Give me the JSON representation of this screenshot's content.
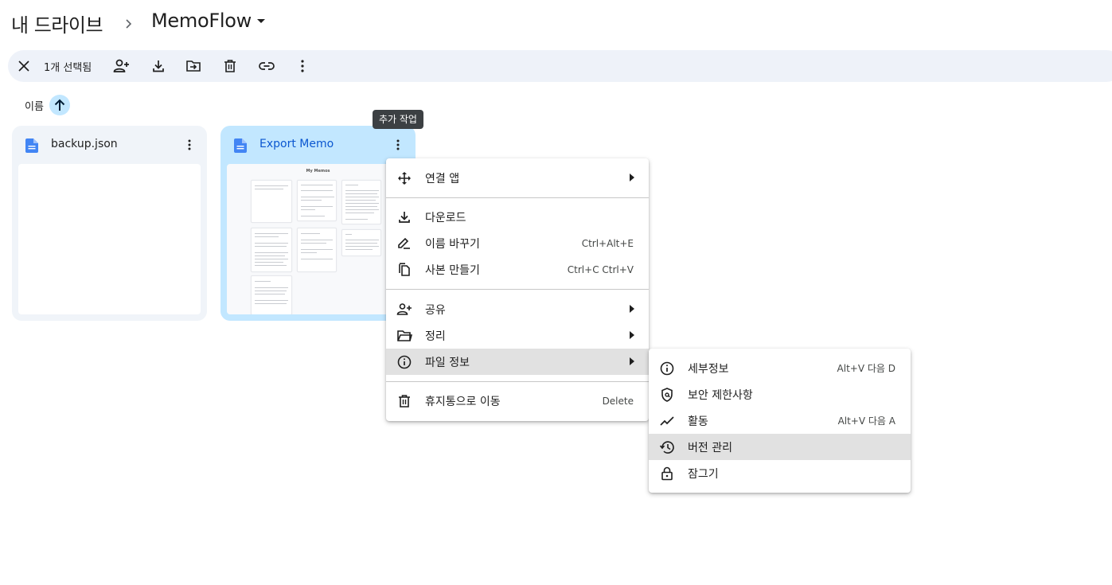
{
  "breadcrumb": {
    "root": "내 드라이브",
    "current": "MemoFlow"
  },
  "selection_bar": {
    "count_label": "1개 선택됨"
  },
  "sort": {
    "label": "이름"
  },
  "tooltip": "추가 작업",
  "files": [
    {
      "name": "backup.json",
      "selected": false
    },
    {
      "name": "Export Memo",
      "selected": true,
      "thumbnail_title": "My Memos"
    }
  ],
  "context_menu": {
    "items": [
      {
        "label": "연결 앱",
        "icon": "open-with-icon",
        "submenu": true
      },
      {
        "label": "다운로드",
        "icon": "download-icon"
      },
      {
        "label": "이름 바꾸기",
        "icon": "rename-icon",
        "shortcut": "Ctrl+Alt+E"
      },
      {
        "label": "사본 만들기",
        "icon": "copy-icon",
        "shortcut": "Ctrl+C Ctrl+V"
      },
      {
        "label": "공유",
        "icon": "share-icon",
        "submenu": true
      },
      {
        "label": "정리",
        "icon": "folder-icon",
        "submenu": true
      },
      {
        "label": "파일 정보",
        "icon": "info-icon",
        "submenu": true,
        "highlighted": true
      },
      {
        "label": "휴지통으로 이동",
        "icon": "trash-icon",
        "shortcut": "Delete"
      }
    ]
  },
  "submenu": {
    "items": [
      {
        "label": "세부정보",
        "icon": "info-icon",
        "shortcut": "Alt+V 다음 D"
      },
      {
        "label": "보안 제한사항",
        "icon": "security-icon"
      },
      {
        "label": "활동",
        "icon": "activity-icon",
        "shortcut": "Alt+V 다음 A"
      },
      {
        "label": "버전 관리",
        "icon": "history-icon",
        "highlighted": true
      },
      {
        "label": "잠그기",
        "icon": "lock-icon"
      }
    ]
  },
  "colors": {
    "accent": "#0b57d0",
    "selected_card": "#c2e7ff",
    "card": "#f0f4f9",
    "file_icon": "#4285f4"
  }
}
